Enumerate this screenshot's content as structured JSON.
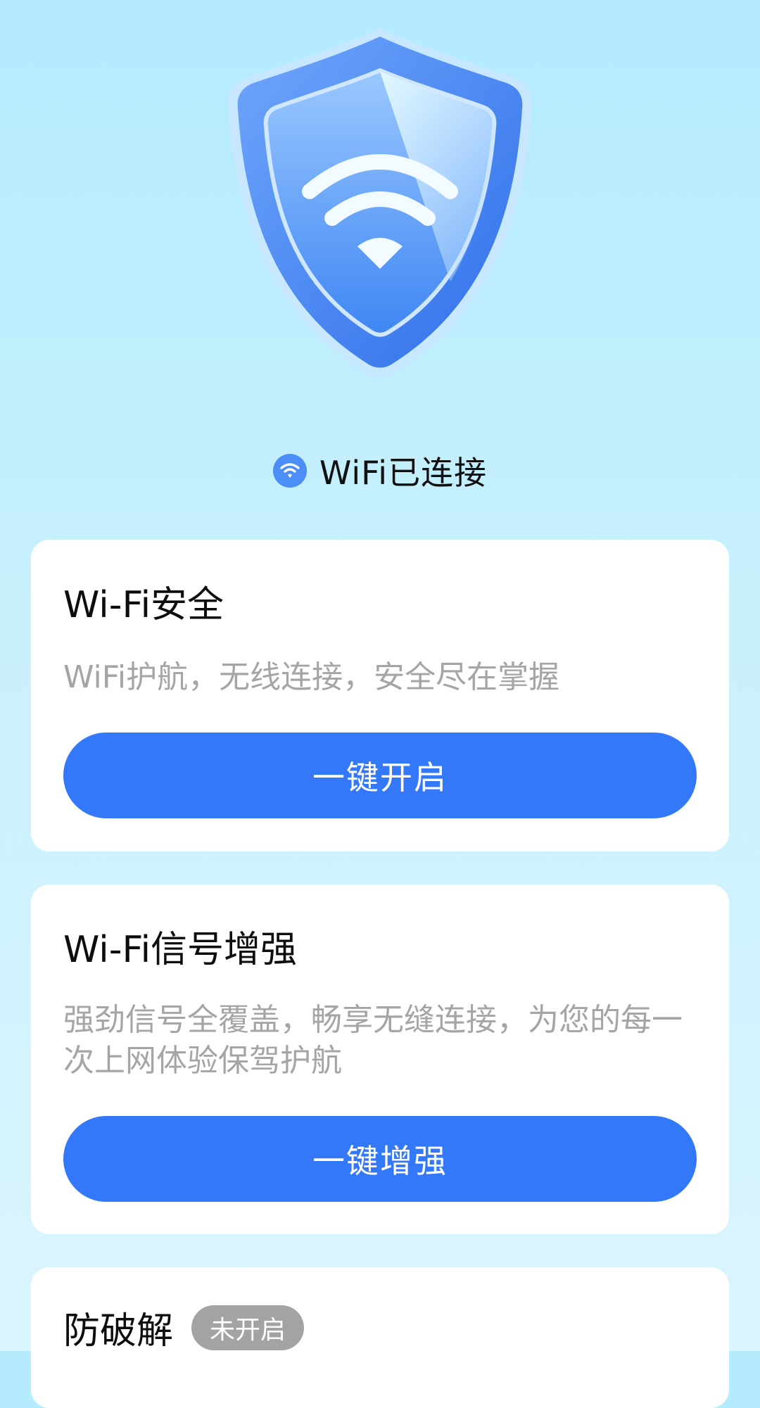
{
  "status": {
    "icon": "wifi-icon",
    "text": "WiFi已连接"
  },
  "cards": [
    {
      "title": "Wi-Fi安全",
      "description": "WiFi护航，无线连接，安全尽在掌握",
      "button_label": "一键开启"
    },
    {
      "title": "Wi-Fi信号增强",
      "description": "强劲信号全覆盖，畅享无缝连接，为您的每一次上网体验保驾护航",
      "button_label": "一键增强"
    },
    {
      "title": "防破解",
      "badge": "未开启"
    }
  ],
  "colors": {
    "accent": "#3478fa",
    "background_top": "#b3ebfd",
    "badge_gray": "#a3a3a3",
    "description_gray": "#a5a5a5"
  }
}
